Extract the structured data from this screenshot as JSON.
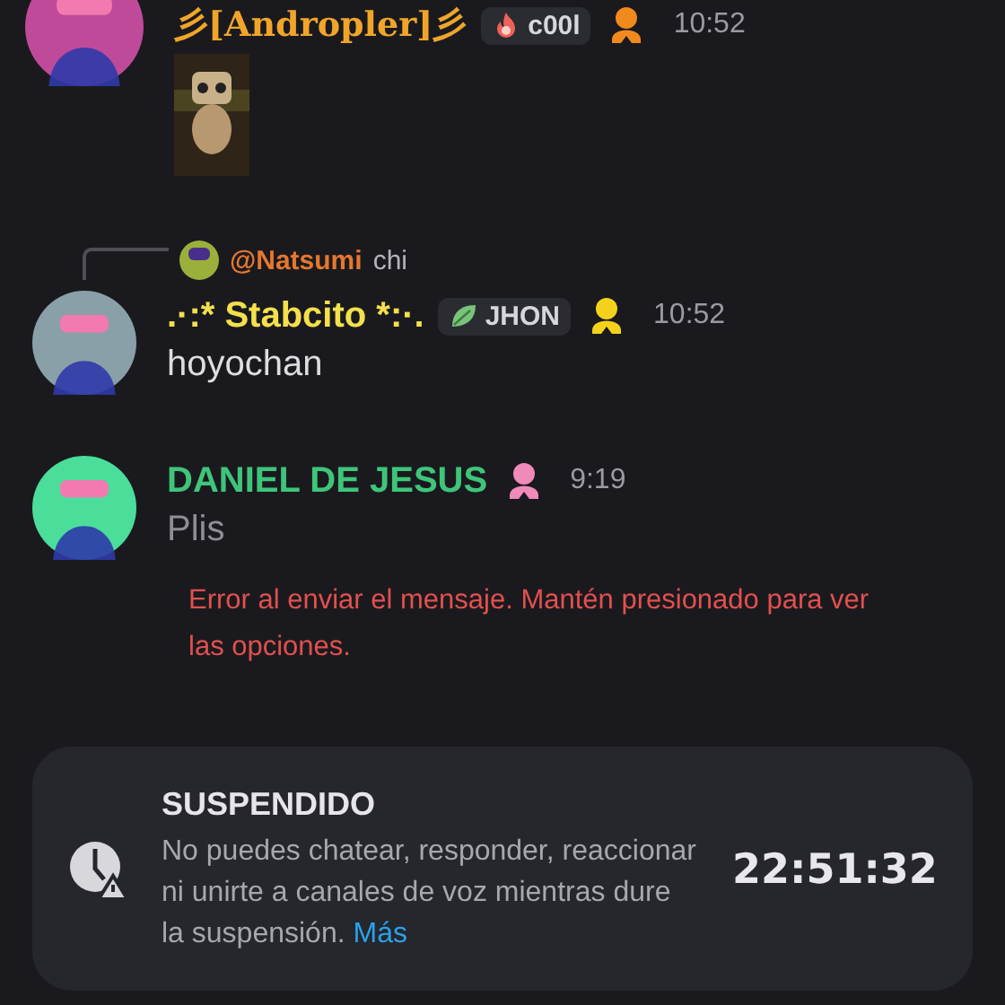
{
  "messages": [
    {
      "author": "彡[Andropler]彡",
      "color": "#f0a52a",
      "tag": {
        "label": "c00l"
      },
      "time": "10:52"
    },
    {
      "reply": {
        "author": "@Natsumi",
        "text": "chi"
      },
      "author": ".·:* Stabcito *:·.",
      "color": "#f3e04c",
      "tag": {
        "label": "JHON"
      },
      "time": "10:52",
      "text": "hoyochan",
      "pending": false
    },
    {
      "author": "DANIEL DE JESUS",
      "color": "#3ec57a",
      "time": "9:19",
      "text": "Plis",
      "pending": true,
      "error": "Error al enviar el mensaje. Mantén presionado para ver las opciones."
    }
  ],
  "notice": {
    "title": "SUSPENDIDO",
    "text": "No puedes chatear, responder, reaccionar ni unirte a canales de voz mientras dure la suspensión.",
    "link": "Más",
    "countdown": "22:51:32"
  }
}
